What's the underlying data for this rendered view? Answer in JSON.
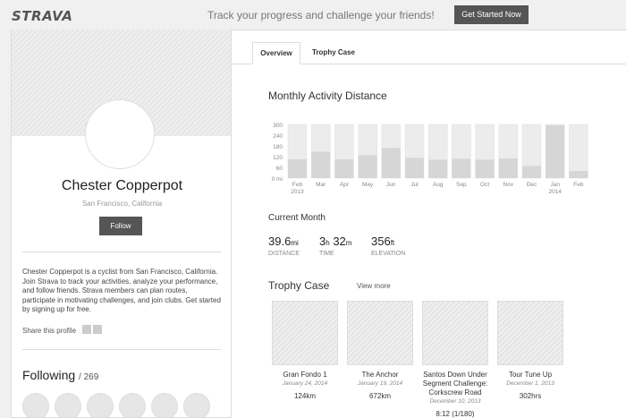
{
  "topbar": {
    "logo": "STRAVA",
    "tagline": "Track your progress and challenge your friends!",
    "cta_label": "Get Started Now"
  },
  "profile": {
    "name": "Chester Copperpot",
    "location": "San Francisco, California",
    "follow_label": "Follow",
    "bio": "Chester Copperpot is a cyclist from San Francisco, California. Join Strava to track your activities, analyze your performance, and follow friends. Strava members can plan routes, participate in motivating challenges, and join clubs. Get started by signing up for free.",
    "share_label": "Share this profile",
    "following_label": "Following",
    "following_count": "/ 269"
  },
  "tabs": [
    {
      "label": "Overview",
      "active": true
    },
    {
      "label": "Trophy Case",
      "active": false
    }
  ],
  "monthly": {
    "title": "Monthly Activity Distance"
  },
  "chart_data": {
    "type": "bar",
    "title": "Monthly Activity Distance",
    "categories": [
      "Feb 2013",
      "Mar",
      "Apr",
      "May",
      "Jun",
      "Jul",
      "Aug",
      "Sep",
      "Oct",
      "Nov",
      "Dec",
      "Jan 2014",
      "Feb"
    ],
    "x_tick_lines": [
      [
        "Feb",
        "2013"
      ],
      [
        "Mar"
      ],
      [
        "Apr"
      ],
      [
        "May"
      ],
      [
        "Jun"
      ],
      [
        "Jul"
      ],
      [
        "Aug"
      ],
      [
        "Sep"
      ],
      [
        "Oct"
      ],
      [
        "Nov"
      ],
      [
        "Dec"
      ],
      [
        "Jan",
        "2014"
      ],
      [
        "Feb"
      ]
    ],
    "values": [
      105,
      148,
      105,
      128,
      168,
      113,
      103,
      108,
      103,
      110,
      68,
      295,
      40
    ],
    "max_values": [
      300,
      300,
      300,
      300,
      300,
      300,
      300,
      300,
      300,
      300,
      300,
      300,
      300
    ],
    "y_ticks": [
      "300",
      "240",
      "180",
      "120",
      "60",
      "0 mi"
    ],
    "ylim": [
      0,
      300
    ],
    "xlabel": "",
    "ylabel": "",
    "grid": true
  },
  "current_month": {
    "title": "Current Month",
    "stats": [
      {
        "value": "39.6",
        "unit": "mi",
        "label": "DISTANCE"
      },
      {
        "value": "3h 32m",
        "label": "TIME",
        "h": "3",
        "h_unit": "h",
        "m": "32",
        "m_unit": "m"
      },
      {
        "value": "356",
        "unit": "ft",
        "label": "ELEVATION"
      }
    ]
  },
  "trophy_case": {
    "title": "Trophy Case",
    "view_more": "View more",
    "trophies": [
      {
        "name": "Gran Fondo 1",
        "date": "January 24, 2014",
        "value": "124km"
      },
      {
        "name": "The Anchor",
        "date": "January 19, 2014",
        "value": "672km"
      },
      {
        "name": "Santos Down Under Segment Challenge: Corkscrew Road",
        "date": "December 10, 2013",
        "value": "8:12 (1/180)"
      },
      {
        "name": "Tour Tune Up",
        "date": "December 1, 2013",
        "value": "302hrs"
      }
    ]
  },
  "colors": {
    "button_bg": "#555555",
    "bar_fill": "#d6d6d6",
    "bar_max": "#ececec"
  }
}
